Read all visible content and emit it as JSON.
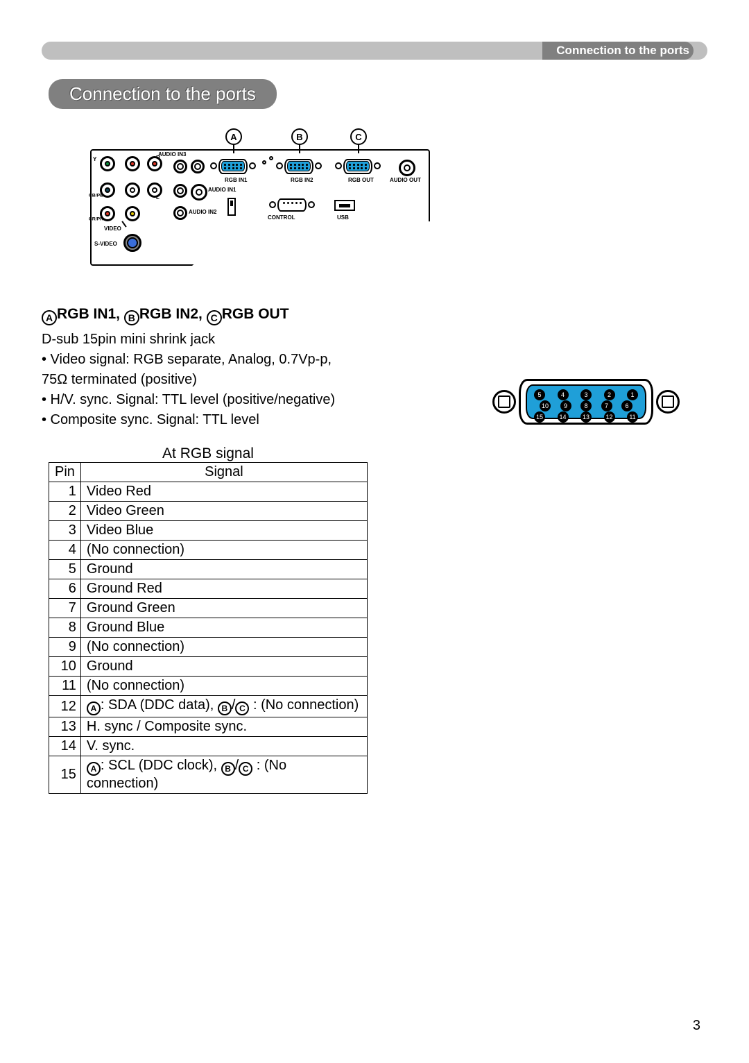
{
  "header": {
    "breadcrumb": "Connection to the ports",
    "section_title": "Connection to the ports"
  },
  "callouts": {
    "A": "A",
    "B": "B",
    "C": "C"
  },
  "panel_labels": {
    "audio_in3": "AUDIO IN3",
    "y": "Y",
    "r": "R",
    "l": "L",
    "cb_pb": "CB/PB",
    "cr_pr": "CR/PR",
    "rgb_in1": "RGB IN1",
    "rgb_in2": "RGB IN2",
    "rgb_out": "RGB OUT",
    "audio_out": "AUDIO OUT",
    "audio_in1": "AUDIO IN1",
    "audio_in2": "AUDIO IN2",
    "control": "CONTROL",
    "usb": "USB",
    "video": "VIDEO",
    "s_video": "S-VIDEO"
  },
  "port_heading": {
    "a": "A",
    "rgb_in1": "RGB IN1, ",
    "b": "B",
    "rgb_in2": "RGB IN2, ",
    "c": "C",
    "rgb_out": "RGB OUT"
  },
  "specs": {
    "line1": " D-sub 15pin mini shrink jack",
    "line2": "• Video signal: RGB separate, Analog, 0.7Vp-p,",
    "line3": "75Ω terminated (positive)",
    "line4": "• H/V. sync. Signal: TTL level (positive/negative)",
    "line5": "• Composite sync. Signal: TTL level"
  },
  "big_connector_pins": {
    "row1": [
      "5",
      "4",
      "3",
      "2",
      "1"
    ],
    "row2": [
      "10",
      "9",
      "8",
      "7",
      "6"
    ],
    "row3": [
      "15",
      "14",
      "13",
      "12",
      "11"
    ]
  },
  "table": {
    "caption": "At RGB signal",
    "head_pin": "Pin",
    "head_signal": "Signal",
    "rows": [
      {
        "pin": "1",
        "signal": "Video Red"
      },
      {
        "pin": "2",
        "signal": "Video Green"
      },
      {
        "pin": "3",
        "signal": "Video Blue"
      },
      {
        "pin": "4",
        "signal": "(No connection)"
      },
      {
        "pin": "5",
        "signal": "Ground"
      },
      {
        "pin": "6",
        "signal": "Ground Red"
      },
      {
        "pin": "7",
        "signal": "Ground Green"
      },
      {
        "pin": "8",
        "signal": "Ground Blue"
      },
      {
        "pin": "9",
        "signal": "(No connection)"
      },
      {
        "pin": "10",
        "signal": "Ground"
      },
      {
        "pin": "11",
        "signal": "(No connection)"
      },
      {
        "pin": "12",
        "complex": true,
        "a": ": SDA (DDC data), ",
        "bc": " : (No connection)"
      },
      {
        "pin": "13",
        "signal": "H. sync / Composite sync."
      },
      {
        "pin": "14",
        "signal": "V. sync."
      },
      {
        "pin": "15",
        "complex": true,
        "a": ": SCL (DDC clock), ",
        "bc": " : (No connection)"
      }
    ]
  },
  "page_number": "3"
}
